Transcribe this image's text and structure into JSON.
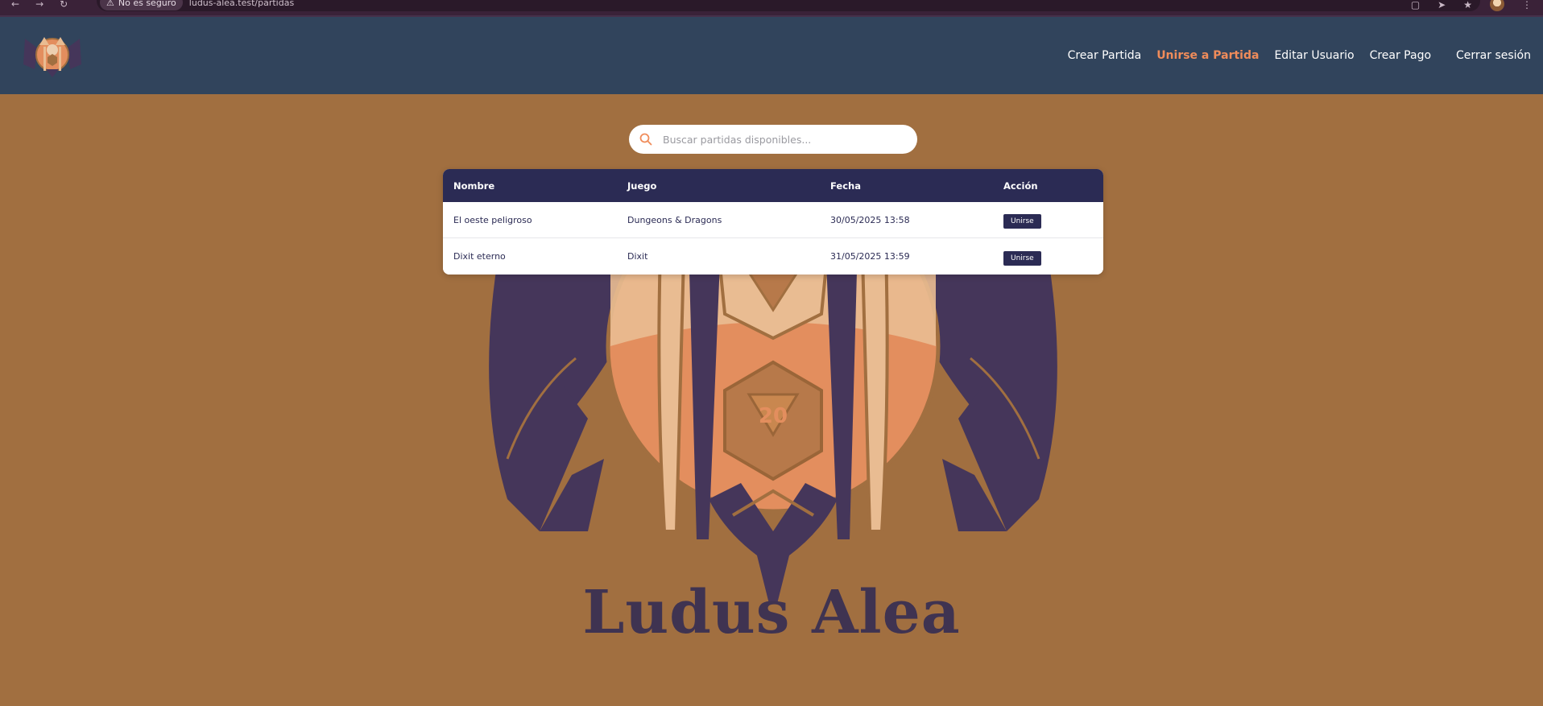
{
  "browser": {
    "security_label": "No es seguro",
    "url": "ludus-alea.test/partidas"
  },
  "nav": {
    "items": [
      {
        "label": "Crear Partida",
        "active": false
      },
      {
        "label": "Unirse a Partida",
        "active": true
      },
      {
        "label": "Editar Usuario",
        "active": false
      },
      {
        "label": "Crear Pago",
        "active": false
      },
      {
        "label": "Cerrar sesión",
        "active": false
      }
    ]
  },
  "search": {
    "placeholder": "Buscar partidas disponibles..."
  },
  "table": {
    "headers": [
      "Nombre",
      "Juego",
      "Fecha",
      "Acción"
    ],
    "rows": [
      {
        "name": "El oeste peligroso",
        "game": "Dungeons & Dragons",
        "date": "30/05/2025 13:58",
        "action": "Unirse"
      },
      {
        "name": "Dixit eterno",
        "game": "Dixit",
        "date": "31/05/2025 13:59",
        "action": "Unirse"
      }
    ]
  },
  "branding": {
    "wordmark": "Ludus Alea",
    "d20_number": "20"
  },
  "colors": {
    "page_bg": "#a16f40",
    "header_bg": "#31445c",
    "accent": "#f08c5a",
    "table_header": "#2b2b54",
    "emblem_wings": "#45365a"
  }
}
